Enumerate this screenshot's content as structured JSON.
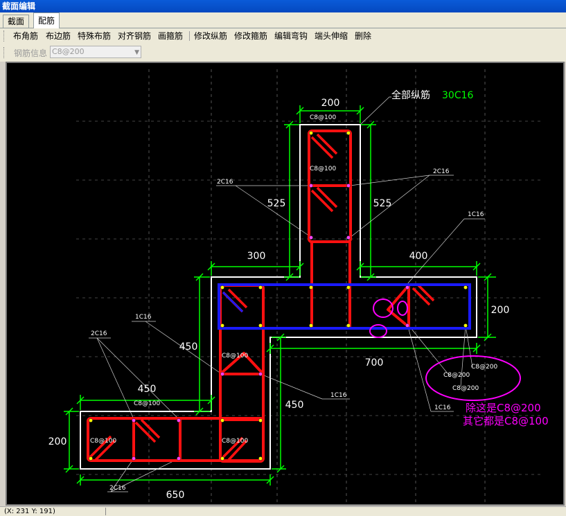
{
  "window": {
    "title": "截面编辑"
  },
  "tabs": [
    {
      "label": "截面"
    },
    {
      "label": "配筋"
    }
  ],
  "toolbar": {
    "items": [
      {
        "label": "布角筋"
      },
      {
        "label": "布边筋"
      },
      {
        "label": "特殊布筋"
      },
      {
        "label": "对齐钢筋"
      },
      {
        "label": "画箍筋"
      },
      {
        "label": "修改纵筋"
      },
      {
        "label": "修改箍筋"
      },
      {
        "label": "编辑弯钩"
      },
      {
        "label": "端头伸缩"
      },
      {
        "label": "删除"
      }
    ]
  },
  "rebar_info": {
    "label": "钢筋信息",
    "value": "C8@200"
  },
  "drawing": {
    "total_rebar_label": "全部纵筋",
    "total_rebar_value": "30C16",
    "dims": {
      "d200_top": "200",
      "d525_left": "525",
      "d525_right": "525",
      "d300": "300",
      "d400": "400",
      "d200_right": "200",
      "d450_mid": "450",
      "d700": "700",
      "d450_left": "450",
      "d450_right": "450",
      "d200_left": "200",
      "d650": "650"
    },
    "stirrups": {
      "s1": "C8@100",
      "s2": "C8@100",
      "s3": "C8@100",
      "s4": "C8@100",
      "s5": "C8@100",
      "s6": "C8@100",
      "s7": "C8@200",
      "s8": "C8@200",
      "s9": "C8@200"
    },
    "rebar_labels": {
      "r2c16_a": "2C16",
      "r2c16_b": "2C16",
      "r1c16_a": "1C16",
      "r1c16_b": "1C16",
      "r2c16_c": "2C16",
      "r1c16_c": "1C16",
      "r1c16_d": "1C16",
      "r2c16_d": "2C16"
    },
    "note_line1": "除这是C8@200",
    "note_line2": "其它都是C8@100"
  },
  "status": {
    "coords": "(X: 231  Y: 191)"
  },
  "colors": {
    "background": "#000000",
    "outline": "#ffffff",
    "rebar": "#ff1010",
    "stirrup_200": "#1a1aff",
    "dimension": "#00ff00",
    "annotation": "#ff00ff",
    "grid": "#8a8a8a"
  }
}
